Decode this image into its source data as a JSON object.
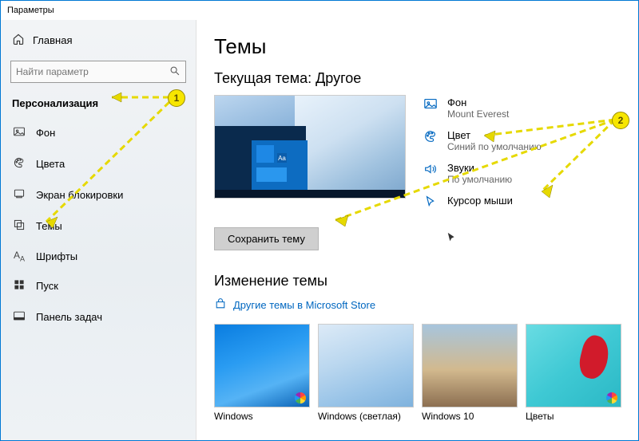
{
  "window": {
    "title": "Параметры"
  },
  "sidebar": {
    "home": "Главная",
    "search_placeholder": "Найти параметр",
    "section": "Персонализация",
    "items": [
      {
        "icon": "picture-icon",
        "label": "Фон"
      },
      {
        "icon": "palette-icon",
        "label": "Цвета"
      },
      {
        "icon": "lockscreen-icon",
        "label": "Экран блокировки"
      },
      {
        "icon": "themes-icon",
        "label": "Темы"
      },
      {
        "icon": "fonts-icon",
        "label": "Шрифты"
      },
      {
        "icon": "start-icon",
        "label": "Пуск"
      },
      {
        "icon": "taskbar-icon",
        "label": "Панель задач"
      }
    ]
  },
  "main": {
    "heading": "Темы",
    "current_label": "Текущая тема: Другое",
    "preview_tile_text": "Aa",
    "props": {
      "bg": {
        "title": "Фон",
        "value": "Mount Everest"
      },
      "color": {
        "title": "Цвет",
        "value": "Синий по умолчанию"
      },
      "sound": {
        "title": "Звуки",
        "value": "По умолчанию"
      },
      "cursor": {
        "title": "Курсор мыши",
        "value": ""
      }
    },
    "save_button": "Сохранить тему",
    "change_heading": "Изменение темы",
    "store_link": "Другие темы в Microsoft Store",
    "themes": [
      {
        "label": "Windows"
      },
      {
        "label": "Windows (светлая)"
      },
      {
        "label": "Windows 10"
      },
      {
        "label": "Цветы"
      }
    ]
  },
  "annotations": {
    "a1": "1",
    "a2": "2"
  }
}
